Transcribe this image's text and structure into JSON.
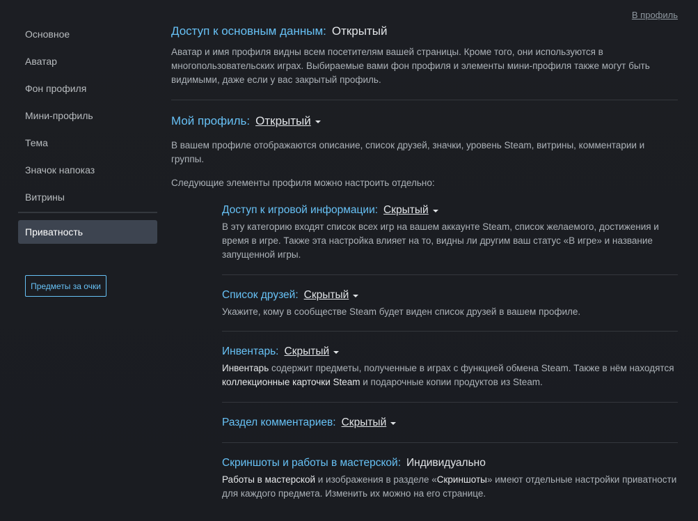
{
  "sidebar": {
    "items": [
      {
        "label": "Основное"
      },
      {
        "label": "Аватар"
      },
      {
        "label": "Фон профиля"
      },
      {
        "label": "Мини-профиль"
      },
      {
        "label": "Тема"
      },
      {
        "label": "Значок напоказ"
      },
      {
        "label": "Витрины"
      }
    ],
    "active": "Приватность",
    "points_button": "Предметы за очки"
  },
  "back_link": "В профиль",
  "basic": {
    "label": "Доступ к основным данным:",
    "value": "Открытый",
    "desc": "Аватар и имя профиля видны всем посетителям вашей страницы. Кроме того, они используются в многопользовательских играх. Выбираемые вами фон профиля и элементы мини-профиля также могут быть видимыми, даже если у вас закрытый профиль."
  },
  "profile": {
    "label": "Мой профиль:",
    "value": "Открытый",
    "desc": "В вашем профиле отображаются описание, список друзей, значки, уровень Steam, витрины, комментарии и группы.",
    "desc2": "Следующие элементы профиля можно настроить отдельно:"
  },
  "game": {
    "label": "Доступ к игровой информации:",
    "value": "Скрытый",
    "desc": "В эту категорию входят список всех игр на вашем аккаунте Steam, список желаемого, достижения и время в игре. Также эта настройка влияет на то, видны ли другим ваш статус «В игре» и название запущенной игры."
  },
  "friends": {
    "label": "Список друзей:",
    "value": "Скрытый",
    "desc": "Укажите, кому в сообществе Steam будет виден список друзей в вашем профиле."
  },
  "inventory": {
    "label": "Инвентарь:",
    "value": "Скрытый",
    "desc_a": "Инвентарь",
    "desc_b": " содержит предметы, полученные в играх с функцией обмена Steam. Также в нём находятся ",
    "desc_c": "коллекционные карточки Steam",
    "desc_d": " и подарочные копии продуктов из Steam."
  },
  "comments": {
    "label": "Раздел комментариев:",
    "value": "Скрытый"
  },
  "screenshots": {
    "label": "Скриншоты и работы в мастерской:",
    "value": "Индивидуально",
    "desc_a": "Работы в мастерской",
    "desc_b": " и изображения в разделе «",
    "desc_c": "Скриншоты",
    "desc_d": "» имеют отдельные настройки приватности для каждого предмета. Изменить их можно на его странице."
  }
}
